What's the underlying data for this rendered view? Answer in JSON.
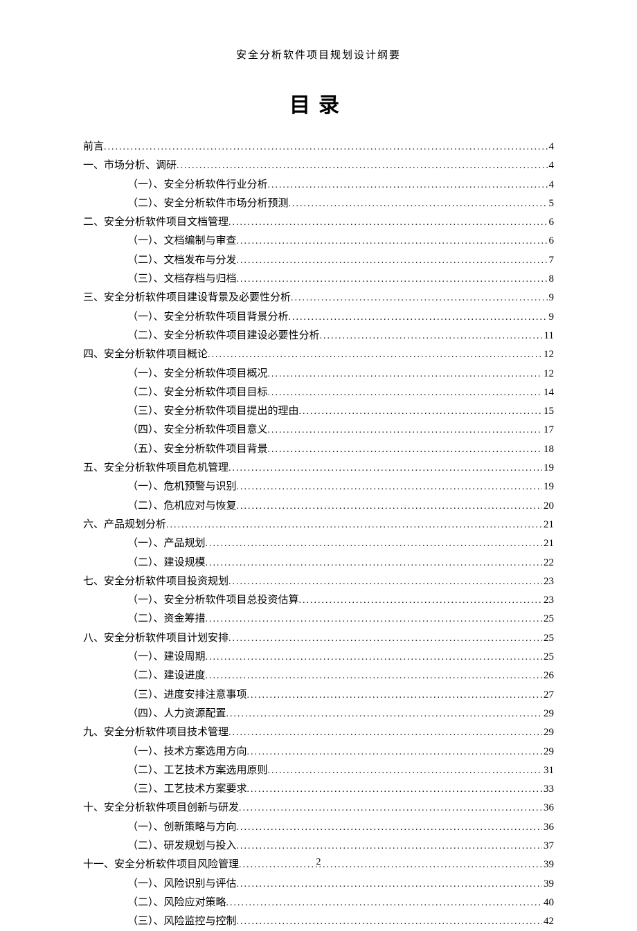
{
  "header": "安全分析软件项目规划设计纲要",
  "title": "目录",
  "pageNumber": "2",
  "toc": [
    {
      "level": 0,
      "label": "前言",
      "page": "4"
    },
    {
      "level": 0,
      "label": "一、市场分析、调研",
      "page": "4"
    },
    {
      "level": 1,
      "label": "（一）、安全分析软件行业分析",
      "page": "4"
    },
    {
      "level": 1,
      "label": "（二）、安全分析软件市场分析预测",
      "page": "5"
    },
    {
      "level": 0,
      "label": "二、安全分析软件项目文档管理",
      "page": "6"
    },
    {
      "level": 1,
      "label": "（一）、文档编制与审查",
      "page": "6"
    },
    {
      "level": 1,
      "label": "（二）、文档发布与分发",
      "page": "7"
    },
    {
      "level": 1,
      "label": "（三）、文档存档与归档",
      "page": "8"
    },
    {
      "level": 0,
      "label": "三、安全分析软件项目建设背景及必要性分析",
      "page": "9"
    },
    {
      "level": 1,
      "label": "（一）、安全分析软件项目背景分析",
      "page": "9"
    },
    {
      "level": 1,
      "label": "（二）、安全分析软件项目建设必要性分析",
      "page": "11"
    },
    {
      "level": 0,
      "label": "四、安全分析软件项目概论",
      "page": "12"
    },
    {
      "level": 1,
      "label": "（一）、安全分析软件项目概况",
      "page": "12"
    },
    {
      "level": 1,
      "label": "（二）、安全分析软件项目目标",
      "page": "14"
    },
    {
      "level": 1,
      "label": "（三）、安全分析软件项目提出的理由",
      "page": "15"
    },
    {
      "level": 1,
      "label": "（四）、安全分析软件项目意义",
      "page": "17"
    },
    {
      "level": 1,
      "label": "（五）、安全分析软件项目背景",
      "page": "18"
    },
    {
      "level": 0,
      "label": "五、安全分析软件项目危机管理",
      "page": "19"
    },
    {
      "level": 1,
      "label": "（一）、危机预警与识别",
      "page": "19"
    },
    {
      "level": 1,
      "label": "（二）、危机应对与恢复",
      "page": "20"
    },
    {
      "level": 0,
      "label": "六、产品规划分析",
      "page": "21"
    },
    {
      "level": 1,
      "label": "（一）、产品规划",
      "page": "21"
    },
    {
      "level": 1,
      "label": "（二）、建设规模",
      "page": "22"
    },
    {
      "level": 0,
      "label": "七、安全分析软件项目投资规划",
      "page": "23"
    },
    {
      "level": 1,
      "label": "（一）、安全分析软件项目总投资估算",
      "page": "23"
    },
    {
      "level": 1,
      "label": "（二）、资金筹措",
      "page": "25"
    },
    {
      "level": 0,
      "label": "八、安全分析软件项目计划安排",
      "page": "25"
    },
    {
      "level": 1,
      "label": "（一）、建设周期",
      "page": "25"
    },
    {
      "level": 1,
      "label": "（二）、建设进度",
      "page": "26"
    },
    {
      "level": 1,
      "label": "（三）、进度安排注意事项",
      "page": "27"
    },
    {
      "level": 1,
      "label": "（四）、人力资源配置",
      "page": "29"
    },
    {
      "level": 0,
      "label": "九、安全分析软件项目技术管理",
      "page": "29"
    },
    {
      "level": 1,
      "label": "（一）、技术方案选用方向",
      "page": "29"
    },
    {
      "level": 1,
      "label": "（二）、工艺技术方案选用原则",
      "page": "31"
    },
    {
      "level": 1,
      "label": "（三）、工艺技术方案要求",
      "page": "33"
    },
    {
      "level": 0,
      "label": "十、安全分析软件项目创新与研发",
      "page": "36"
    },
    {
      "level": 1,
      "label": "（一）、创新策略与方向",
      "page": "36"
    },
    {
      "level": 1,
      "label": "（二）、研发规划与投入",
      "page": "37"
    },
    {
      "level": 0,
      "label": "十一、安全分析软件项目风险管理",
      "page": "39"
    },
    {
      "level": 1,
      "label": "（一）、风险识别与评估",
      "page": "39"
    },
    {
      "level": 1,
      "label": "（二）、风险应对策略",
      "page": "40"
    },
    {
      "level": 1,
      "label": "（三）、风险监控与控制",
      "page": "42"
    }
  ]
}
